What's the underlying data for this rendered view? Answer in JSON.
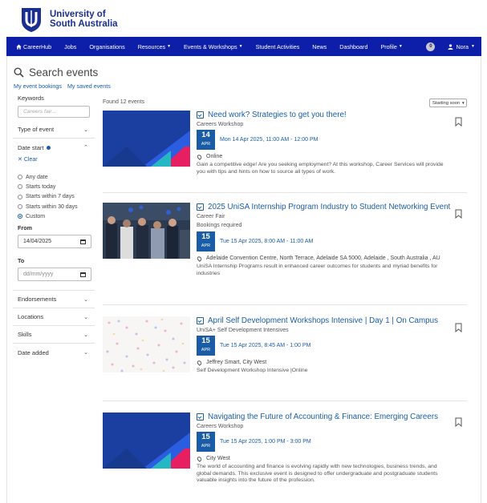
{
  "university": {
    "name_line1": "University of",
    "name_line2": "South Australia"
  },
  "nav": {
    "items": [
      {
        "label": "CareerHub",
        "icon": "home-icon",
        "dropdown": false
      },
      {
        "label": "Jobs",
        "dropdown": false
      },
      {
        "label": "Organisations",
        "dropdown": false
      },
      {
        "label": "Resources",
        "dropdown": true
      },
      {
        "label": "Events & Workshops",
        "dropdown": true
      },
      {
        "label": "Student Activities",
        "dropdown": false
      },
      {
        "label": "News",
        "dropdown": false
      },
      {
        "label": "Dashboard",
        "dropdown": false
      },
      {
        "label": "Profile",
        "dropdown": true
      }
    ],
    "notifications": "0",
    "user": "Nora"
  },
  "page": {
    "title": "Search events",
    "my_bookings": "My event bookings",
    "my_saved": "My saved events"
  },
  "filters": {
    "keywords_label": "Keywords",
    "keywords_placeholder": "Careers fair...",
    "type_of_event": "Type of event",
    "date_start": "Date start",
    "clear": "Clear",
    "date_options": [
      "Any date",
      "Starts today",
      "Starts within 7 days",
      "Starts within 30 days",
      "Custom"
    ],
    "selected_option": "Custom",
    "from_label": "From",
    "from_value": "14/04/2025",
    "to_label": "To",
    "to_placeholder": "dd/mm/yyyy",
    "endorsements": "Endorsements",
    "locations": "Locations",
    "skills": "Skills",
    "date_added": "Date added"
  },
  "results": {
    "found_text": "Found 12 events",
    "sort_label": "Starting soon"
  },
  "events": [
    {
      "title": "Need work? Strategies to get you there!",
      "type": "Careers Workshop",
      "extra": "",
      "day": "14",
      "month": "APR",
      "when": "Mon 14 Apr 2025, 11:00 AM - 12:00 PM",
      "location": "Online",
      "description": "Gain a competitive edge! Are you seeking employment? At this workshop, Career Services will provide you with tips and hints on how to source all types of work."
    },
    {
      "title": "2025 UniSA Internship Program Industry to Student Networking Event",
      "type": "Career Fair",
      "extra": "Bookings required",
      "day": "15",
      "month": "APR",
      "when": "Tue 15 Apr 2025, 8:00 AM - 11:00 AM",
      "location": "Adelaide Convention Centre, North Terrace, Adelaide SA 5000, Adelaide , South Australia , AU",
      "description": "UniSA Internship Programs result in enhanced career outcomes for students and myriad benefits for industries"
    },
    {
      "title": "April Self Development Workshops Intensive | Day 1 | On Campus",
      "type": "UniSA+ Self Development Intensives",
      "extra": "",
      "day": "15",
      "month": "APR",
      "when": "Tue 15 Apr 2025, 8:45 AM - 1:00 PM",
      "location": "Jeffrey Smart, City West",
      "description": "Self Development Workshop Intensive |Online"
    },
    {
      "title": "Navigating the Future of Accounting & Finance: Emerging Careers",
      "type": "Careers Workshop",
      "extra": "",
      "day": "15",
      "month": "APR",
      "when": "Tue 15 Apr 2025, 1:00 PM - 3:00 PM",
      "location": "City West",
      "description": "The world of accounting and finance is evolving rapidly with new technologies, business trends, and global demands. This exclusive event is designed to offer undergraduate and postgraduate students valuable insights into the future of the profession."
    }
  ],
  "colors": {
    "nav": "#0d1ea8",
    "link": "#1a5da6",
    "brand": "#1a2f8f"
  }
}
